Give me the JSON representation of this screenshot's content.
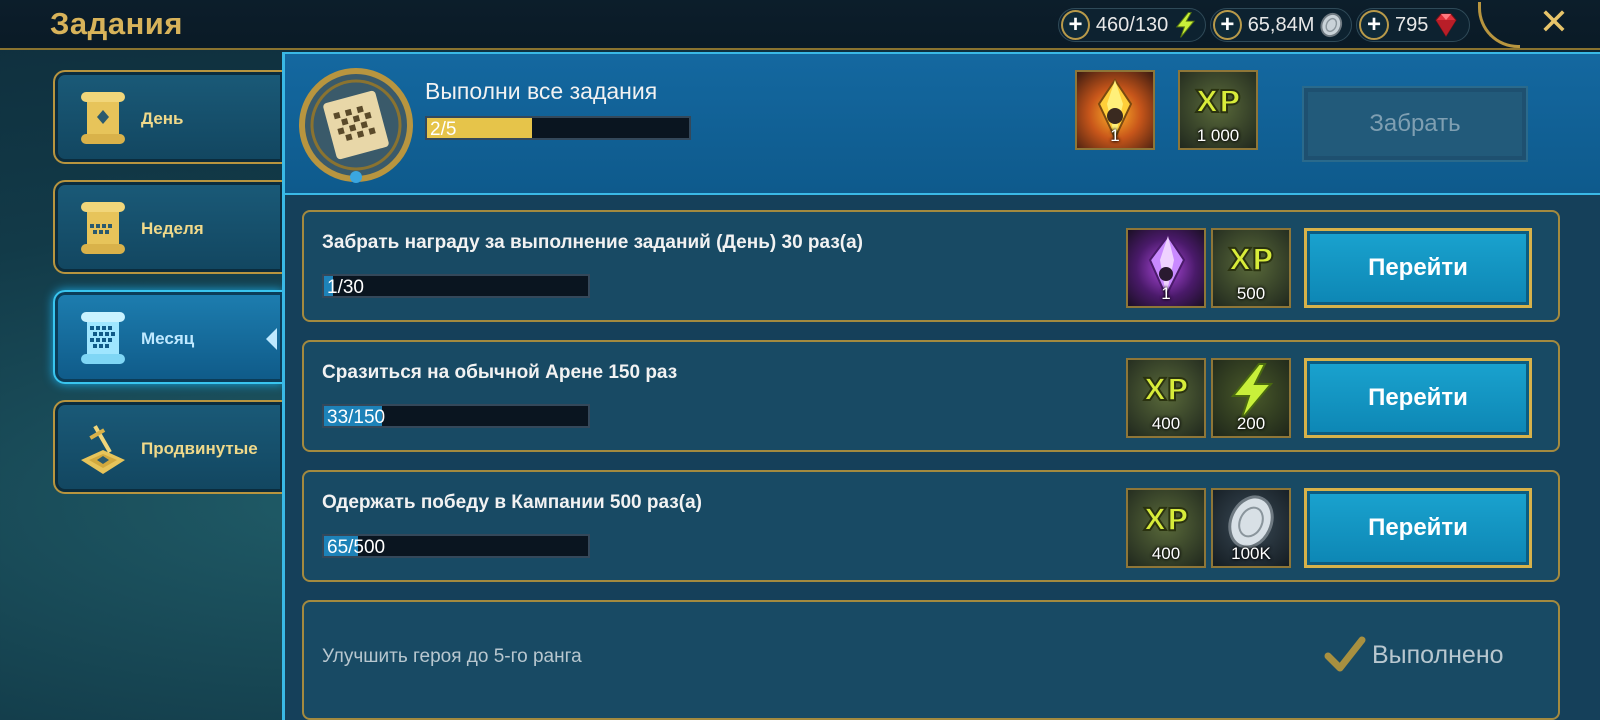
{
  "header": {
    "title": "Задания",
    "close_icon": "close-icon",
    "currencies": [
      {
        "value": "460/130",
        "icon": "energy-icon",
        "color": "#c8f03a"
      },
      {
        "value": "65,84M",
        "icon": "silver-coin-icon",
        "color": "#c9d2d8"
      },
      {
        "value": "795",
        "icon": "ruby-gem-icon",
        "color": "#e0303a"
      }
    ]
  },
  "sidebar": {
    "items": [
      {
        "label": "День",
        "icon": "scroll-day-icon",
        "active": false
      },
      {
        "label": "Неделя",
        "icon": "scroll-week-icon",
        "active": false
      },
      {
        "label": "Месяц",
        "icon": "scroll-month-icon",
        "active": true
      },
      {
        "label": "Продвинутые",
        "icon": "sword-map-icon",
        "active": false
      }
    ]
  },
  "summary": {
    "title": "Выполни все задания",
    "progress_text": "2/5",
    "progress_fraction": 0.4,
    "rewards": [
      {
        "icon": "legendary-shard-icon",
        "count": "1"
      },
      {
        "icon": "xp-icon",
        "count": "1 000",
        "label": "XP"
      }
    ],
    "collect_label": "Забрать"
  },
  "tasks": [
    {
      "title": "Забрать награду за выполнение заданий (День) 30 раз(а)",
      "progress_text": "1/30",
      "progress_fraction": 0.0333,
      "rewards": [
        {
          "icon": "void-shard-icon",
          "count": "1"
        },
        {
          "icon": "xp-icon",
          "count": "500",
          "label": "XP"
        }
      ],
      "button_label": "Перейти"
    },
    {
      "title": "Сразиться на обычной Арене 150 раз",
      "progress_text": "33/150",
      "progress_fraction": 0.22,
      "rewards": [
        {
          "icon": "xp-icon",
          "count": "400",
          "label": "XP"
        },
        {
          "icon": "energy-icon",
          "count": "200"
        }
      ],
      "button_label": "Перейти"
    },
    {
      "title": "Одержать победу в Кампании 500 раз(а)",
      "progress_text": "65/500",
      "progress_fraction": 0.13,
      "rewards": [
        {
          "icon": "xp-icon",
          "count": "400",
          "label": "XP"
        },
        {
          "icon": "silver-coin-icon",
          "count": "100K"
        }
      ],
      "button_label": "Перейти"
    },
    {
      "title": "Улучшить героя до 5-го ранга",
      "status": "Выполнено",
      "status_icon": "checkmark-icon"
    }
  ],
  "colors": {
    "gold": "#d8b35a",
    "progress_gold": "#e6c44a",
    "progress_blue": "#1d82b8",
    "accent_blue": "#3ab9e6"
  }
}
